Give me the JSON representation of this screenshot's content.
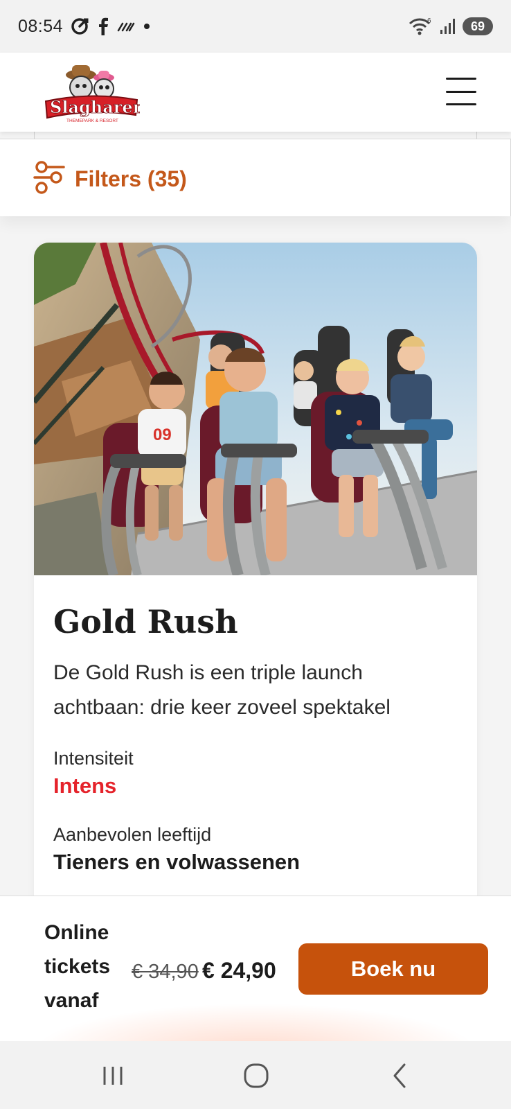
{
  "status_bar": {
    "time": "08:54",
    "battery": "69",
    "left_icons": [
      "sync-icon",
      "facebook-icon",
      "signal-off-icon",
      "dot-icon"
    ],
    "right_icons": [
      "wifi-icon",
      "cell-signal-icon",
      "battery-icon"
    ],
    "wifi_badge": "6"
  },
  "header": {
    "logo_text": "Slagharen",
    "logo_subtext": "THEMEPARK & RESORT",
    "menu_icon": "hamburger-icon"
  },
  "filters": {
    "label": "Filters (35)",
    "icon": "sliders-icon",
    "accent_color": "#c4581a"
  },
  "card": {
    "title": "Gold Rush",
    "description": "De Gold Rush is een triple launch achtbaan: drie keer zoveel spektakel",
    "intensity_label": "Intensiteit",
    "intensity_value": "Intens",
    "intensity_color": "#e5232b",
    "age_label": "Aanbevolen leeftijd",
    "age_value": "Tieners en volwassenen"
  },
  "booking": {
    "label": "Online tickets vanaf",
    "old_price": "€ 34,90",
    "new_price": "€ 24,90",
    "button_label": "Boek nu",
    "button_color": "#c6520c"
  },
  "nav_bar": {
    "icons": [
      "recent-apps-icon",
      "home-icon",
      "back-icon"
    ]
  }
}
